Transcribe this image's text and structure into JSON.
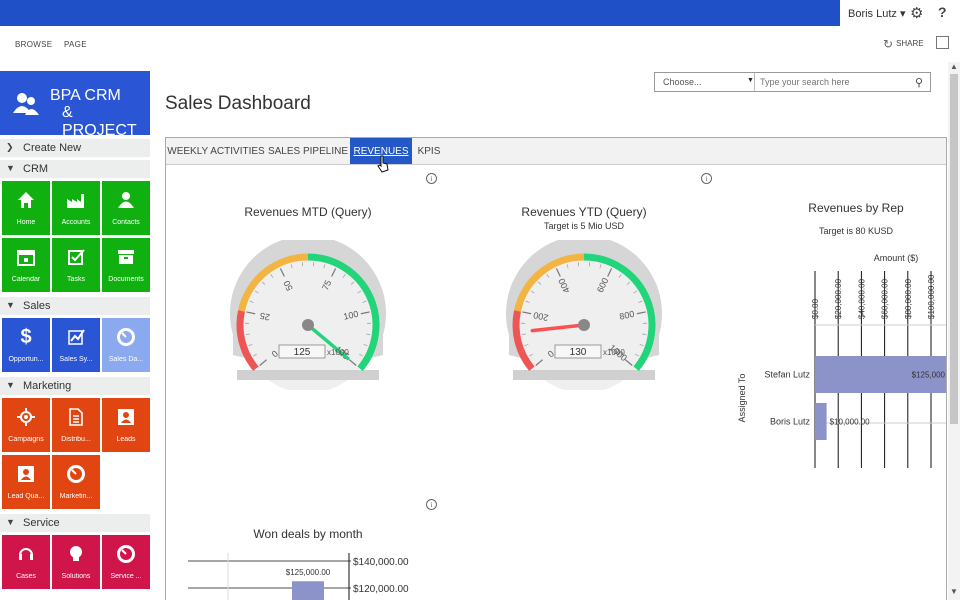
{
  "user": {
    "name": "Boris Lutz"
  },
  "ribbon": {
    "browse": "BROWSE",
    "page": "PAGE",
    "share": "SHARE"
  },
  "logo": {
    "line1": "BPA CRM",
    "line2": "& PROJECT"
  },
  "nav": {
    "create_new": "Create New",
    "sections": [
      {
        "label": "CRM",
        "tiles": [
          "Home",
          "Accounts",
          "Contacts",
          "Calendar",
          "Tasks",
          "Documents"
        ]
      },
      {
        "label": "Sales",
        "tiles": [
          "Opportun...",
          "Sales Sy...",
          "Sales Da..."
        ]
      },
      {
        "label": "Marketing",
        "tiles": [
          "Campaigns",
          "Distribu...",
          "Leads",
          "Lead Qua...",
          "Marketin..."
        ]
      },
      {
        "label": "Service",
        "tiles": [
          "Cases",
          "Solutions",
          "Service ..."
        ]
      }
    ]
  },
  "page_title": "Sales Dashboard",
  "search": {
    "scope": "Choose...",
    "placeholder": "Type your search here"
  },
  "tabs": [
    "WEEKLY ACTIVITIES",
    "SALES PIPELINE",
    "REVENUES",
    "KPIS"
  ],
  "colors": {
    "top_bar": "#2050c8",
    "tab_active": "#2458c6",
    "bar": "#8b93c8",
    "gauge_green": "#22d47a",
    "gauge_yellow": "#f2b544",
    "gauge_red": "#ee5555",
    "needle": "#ff4f4f"
  },
  "chart_data": [
    {
      "type": "gauge",
      "title": "Revenues MTD (Query)",
      "value": 125,
      "value_label": "125",
      "unit": "x1000",
      "min": 0,
      "max": 125,
      "ticks": [
        "0",
        "25",
        "50",
        "75",
        "100",
        "125"
      ],
      "bands": [
        {
          "from": 0,
          "to": 25,
          "color": "#ee5555"
        },
        {
          "from": 25,
          "to": 62.5,
          "color": "#f2b544"
        },
        {
          "from": 62.5,
          "to": 125,
          "color": "#22d47a"
        }
      ]
    },
    {
      "type": "gauge",
      "title": "Revenues YTD (Query)",
      "subtitle": "Target is 5 Mio USD",
      "value": 130,
      "value_label": "130",
      "unit": "x1000",
      "min": 0,
      "max": 1000,
      "ticks": [
        "0",
        "200",
        "400",
        "600",
        "800",
        "1000"
      ],
      "bands": [
        {
          "from": 0,
          "to": 200,
          "color": "#ee5555"
        },
        {
          "from": 200,
          "to": 500,
          "color": "#f2b544"
        },
        {
          "from": 500,
          "to": 1000,
          "color": "#22d47a"
        }
      ]
    },
    {
      "type": "bar",
      "orientation": "horizontal",
      "title": "Revenues by Rep",
      "subtitle": "Target is 80 KUSD",
      "xlabel": "Amount ($)",
      "ylabel": "Assigned To",
      "x_ticks": [
        "$0.00",
        "$20,000.00",
        "$40,000.00",
        "$60,000.00",
        "$80,000.00",
        "$100,000.00"
      ],
      "xlim": [
        0,
        100000
      ],
      "categories": [
        "Stefan Lutz",
        "Boris Lutz"
      ],
      "values": [
        125000,
        10000
      ],
      "value_labels": [
        "$125,000",
        "$10,000.00"
      ]
    },
    {
      "type": "bar",
      "title": "Won deals by month",
      "y_ticks": [
        "$140,000.00",
        "$120,000.00"
      ],
      "values": [
        125000
      ],
      "value_labels": [
        "$125,000.00"
      ]
    }
  ]
}
